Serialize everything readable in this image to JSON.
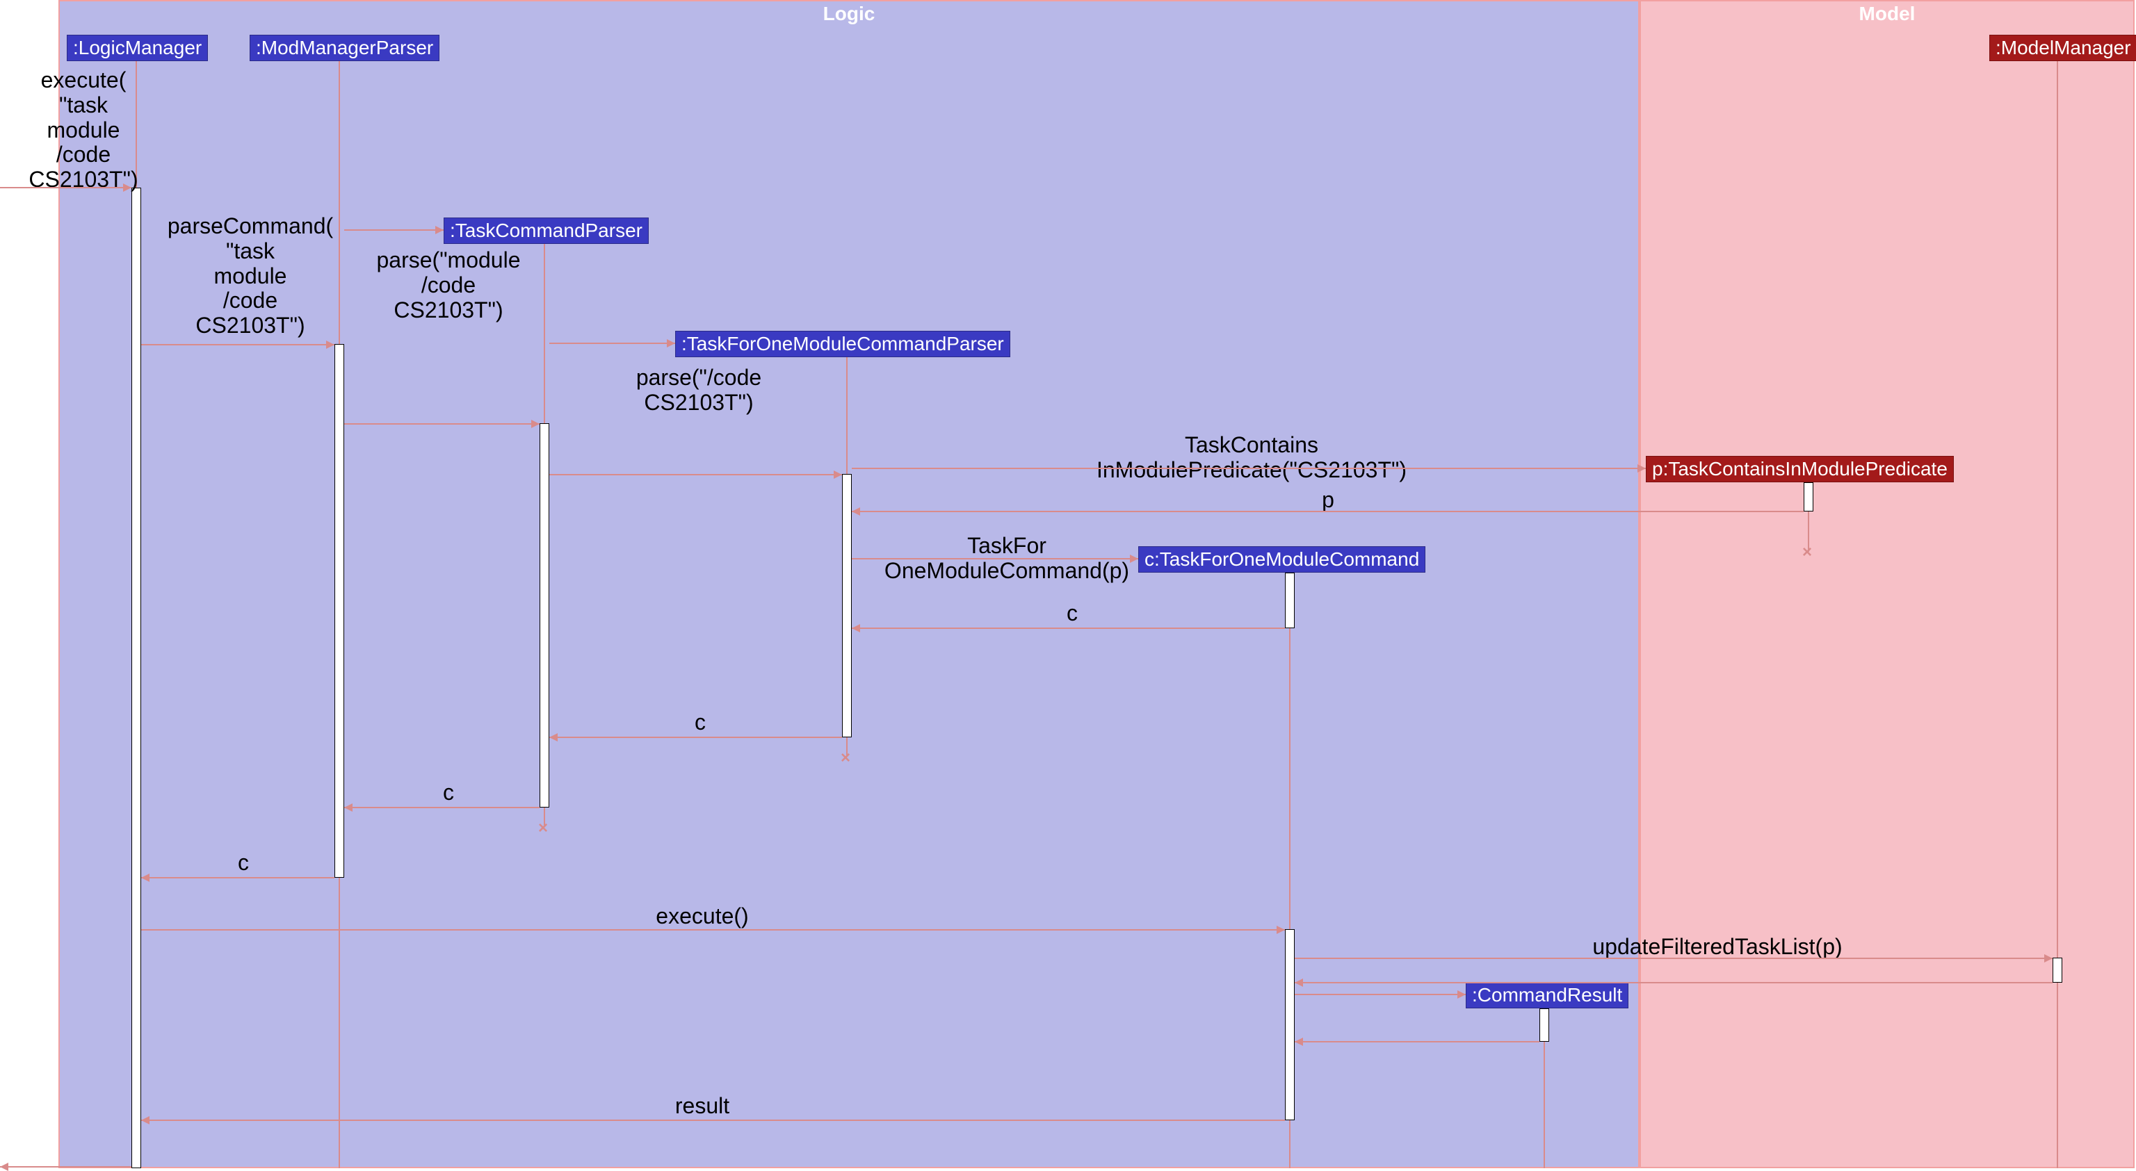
{
  "frames": {
    "logic": {
      "title": "Logic"
    },
    "model": {
      "title": "Model"
    }
  },
  "lifelines": {
    "logicManager": ":LogicManager",
    "modManagerParser": ":ModManagerParser",
    "taskCommandParser": ":TaskCommandParser",
    "taskForOneModuleCommandParser": ":TaskForOneModuleCommandParser",
    "predicate": "p:TaskContainsInModulePredicate",
    "taskForOneModuleCommand": "c:TaskForOneModuleCommand",
    "commandResult": ":CommandResult",
    "modelManager": ":ModelManager"
  },
  "messages": {
    "execute_in": "execute(\n\"task\nmodule\n/code\nCS2103T\")",
    "parseCommand": "parseCommand(\n\"task\nmodule\n/code\nCS2103T\")",
    "parse1": "parse(\"module\n/code\nCS2103T\")",
    "parse2": "parse(\"/code\nCS2103T\")",
    "predicateCtor": "TaskContains\nInModulePredicate(\"CS2103T\")",
    "p_return": "p",
    "commandCtor": "TaskFor\nOneModuleCommand(p)",
    "c_return1": "c",
    "c_return2": "c",
    "c_return3": "c",
    "c_return4": "c",
    "executeCall": "execute()",
    "updateFiltered": "updateFilteredTaskList(p)",
    "result": "result"
  }
}
